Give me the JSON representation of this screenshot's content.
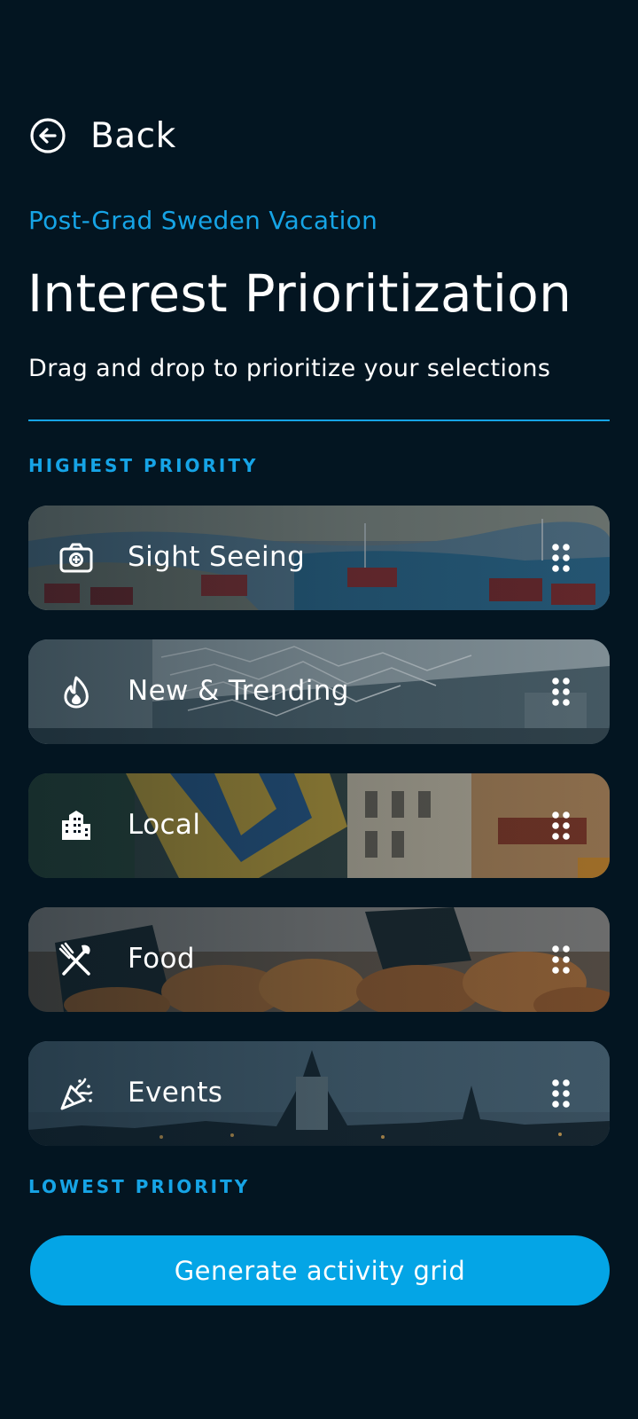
{
  "nav": {
    "back_label": "Back",
    "back_icon": "arrow-left-circle-icon"
  },
  "header": {
    "trip_name": "Post-Grad Sweden Vacation",
    "title": "Interest Prioritization",
    "subtitle": "Drag and drop to prioritize your selections"
  },
  "priority": {
    "highest_label": "HIGHEST PRIORITY",
    "lowest_label": "LOWEST PRIORITY"
  },
  "interests": [
    {
      "label": "Sight Seeing",
      "icon": "camera-icon"
    },
    {
      "label": "New & Trending",
      "icon": "flame-icon"
    },
    {
      "label": "Local",
      "icon": "city-buildings-icon"
    },
    {
      "label": "Food",
      "icon": "fork-knife-icon"
    },
    {
      "label": "Events",
      "icon": "party-popper-icon"
    }
  ],
  "actions": {
    "generate_label": "Generate activity grid"
  },
  "colors": {
    "background": "#031521",
    "accent": "#16a4e6",
    "button": "#04a5e6",
    "text": "#ffffff"
  }
}
